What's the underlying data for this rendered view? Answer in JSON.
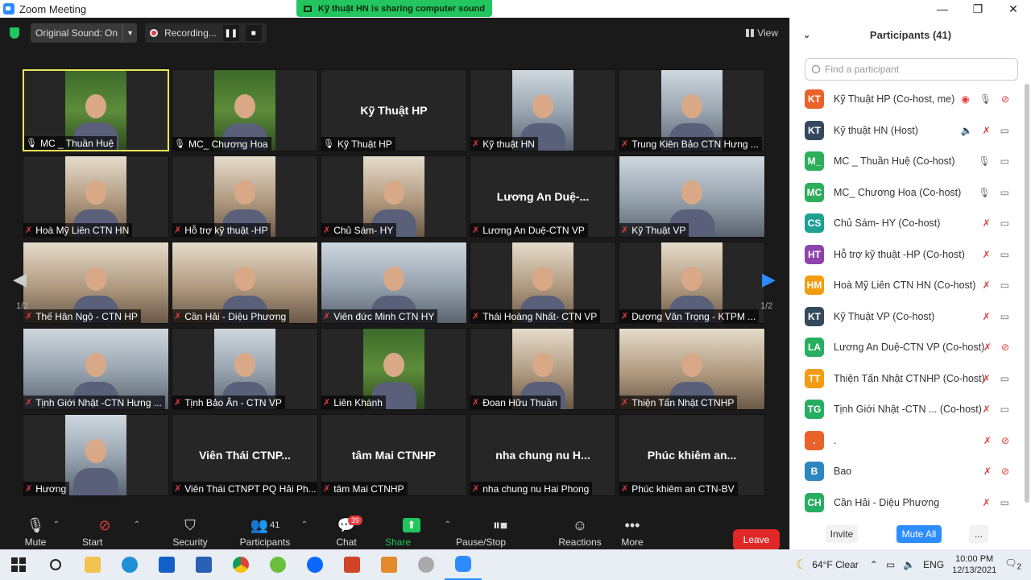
{
  "window": {
    "title": "Zoom Meeting",
    "share_banner": "Kỹ thuật HN is sharing computer sound"
  },
  "topbar": {
    "original_sound": "Original Sound: On",
    "recording": "Recording...",
    "view": "View"
  },
  "tiles": [
    {
      "label": "MC _ Thuần Huệ",
      "type": "video",
      "style": "green",
      "mic": "ok"
    },
    {
      "label": "MC_ Chương Hoa",
      "type": "video",
      "style": "green",
      "mic": "ok"
    },
    {
      "label": "Kỹ Thuật HP",
      "type": "name",
      "big": "Kỹ Thuật HP",
      "mic": "ok"
    },
    {
      "label": "Kỹ thuật HN",
      "type": "video",
      "style": "blue"
    },
    {
      "label": "Trung Kiên Bảo CTN Hưng ...",
      "type": "video",
      "style": "blue"
    },
    {
      "label": "Hoà Mỹ Liên CTN HN",
      "type": "video",
      "style": "warm"
    },
    {
      "label": "Hỗ trợ kỹ thuật -HP",
      "type": "video",
      "style": "warm"
    },
    {
      "label": "Chủ Sám- HY",
      "type": "video",
      "style": "warm"
    },
    {
      "label": "Lương An Duệ-CTN VP",
      "type": "name",
      "big": "Lương An Duệ-..."
    },
    {
      "label": "Kỹ Thuật VP",
      "type": "video",
      "style": "blue",
      "full": true
    },
    {
      "label": "Thế Hân Ngộ - CTN HP",
      "type": "video",
      "style": "warm",
      "full": true
    },
    {
      "label": "Cần Hải - Diệu Phương",
      "type": "video",
      "style": "warm",
      "full": true
    },
    {
      "label": "Viên đức Minh CTN HY",
      "type": "video",
      "style": "blue",
      "full": true
    },
    {
      "label": "Thái Hoàng Nhất- CTN VP",
      "type": "video",
      "style": "warm"
    },
    {
      "label": "Dương Văn Trọng - KTPM ...",
      "type": "video",
      "style": "warm"
    },
    {
      "label": "Tịnh Giới Nhật -CTN Hưng ...",
      "type": "video",
      "style": "blue",
      "full": true
    },
    {
      "label": "Tịnh Bảo Ân - CTN VP",
      "type": "video",
      "style": "blue"
    },
    {
      "label": "Liên Khánh",
      "type": "video",
      "style": "green"
    },
    {
      "label": "Đoan Hữu Thuần",
      "type": "video",
      "style": "warm"
    },
    {
      "label": "Thiện Tấn Nhật CTNHP",
      "type": "video",
      "style": "warm",
      "full": true
    },
    {
      "label": "Hương",
      "type": "video",
      "style": "blue"
    },
    {
      "label": "Viên Thái CTNPT PQ Hải Ph...",
      "type": "name",
      "big": "Viên Thái CTNP..."
    },
    {
      "label": "tâm Mai CTNHP",
      "type": "name",
      "big": "tâm Mai CTNHP"
    },
    {
      "label": "nha chung nu Hai Phong",
      "type": "name",
      "big": "nha chung nu H..."
    },
    {
      "label": "Phúc khiêm an CTN-BV",
      "type": "name",
      "big": "Phúc khiêm an..."
    }
  ],
  "pager": {
    "left": "1/2",
    "right": "1/2"
  },
  "toolbar": {
    "mute": "Mute",
    "start_video": "Start Video",
    "security": "Security",
    "participants": "Participants",
    "participants_count": "41",
    "chat": "Chat",
    "chat_badge": "39",
    "share": "Share Screen",
    "pause_stop": "Pause/Stop Recording",
    "reactions": "Reactions",
    "more": "More",
    "leave": "Leave"
  },
  "panel": {
    "title": "Participants (41)",
    "search_placeholder": "Find a participant",
    "invite": "Invite",
    "mute_all": "Mute All",
    "more": "...",
    "participants": [
      {
        "initials": "KT",
        "name": "Kỹ Thuật HP (Co-host, me)",
        "color": "#e8622a",
        "rec": true,
        "mic": "on",
        "vid": "off"
      },
      {
        "initials": "KT",
        "name": "Kỹ thuật HN (Host)",
        "color": "#34495e",
        "speaker": true,
        "mic": "off",
        "vid": "on"
      },
      {
        "initials": "M_",
        "name": "MC _ Thuần Huệ (Co-host)",
        "color": "#2eae5a",
        "mic": "on",
        "vid": "on"
      },
      {
        "initials": "MC",
        "name": "MC_ Chương Hoa (Co-host)",
        "color": "#2eae5a",
        "mic": "on",
        "vid": "on"
      },
      {
        "initials": "CS",
        "name": "Chủ Sám- HY (Co-host)",
        "color": "#1fa093",
        "mic": "off",
        "vid": "on"
      },
      {
        "initials": "HT",
        "name": "Hỗ trợ kỹ thuật -HP (Co-host)",
        "color": "#8e44ad",
        "mic": "off",
        "vid": "on"
      },
      {
        "initials": "HM",
        "name": "Hoà Mỹ Liên CTN HN (Co-host)",
        "color": "#f39c12",
        "mic": "off",
        "vid": "on"
      },
      {
        "initials": "KT",
        "name": "Kỹ Thuật VP (Co-host)",
        "color": "#34495e",
        "mic": "off",
        "vid": "on"
      },
      {
        "initials": "LA",
        "name": "Lương An Duệ-CTN VP (Co-host)",
        "color": "#27ae60",
        "mic": "off",
        "vid": "off"
      },
      {
        "initials": "TT",
        "name": "Thiện Tấn Nhật CTNHP (Co-host)",
        "color": "#f39c12",
        "mic": "off",
        "vid": "on"
      },
      {
        "initials": "TG",
        "name": "Tịnh Giới Nhật -CTN ...    (Co-host)",
        "color": "#27ae60",
        "mic": "off",
        "vid": "on"
      },
      {
        "initials": ".",
        "name": ".",
        "color": "#e8622a",
        "mic": "off",
        "vid": "off"
      },
      {
        "initials": "B",
        "name": "Bao",
        "color": "#2e86c1",
        "mic": "off",
        "vid": "off"
      },
      {
        "initials": "CH",
        "name": "Cần Hải - Diệu Phương",
        "color": "#27ae60",
        "mic": "off",
        "vid": "on"
      }
    ]
  },
  "taskbar": {
    "weather": "64°F  Clear",
    "lang": "ENG",
    "time": "10:00 PM",
    "date": "12/13/2021",
    "notif": "2"
  }
}
